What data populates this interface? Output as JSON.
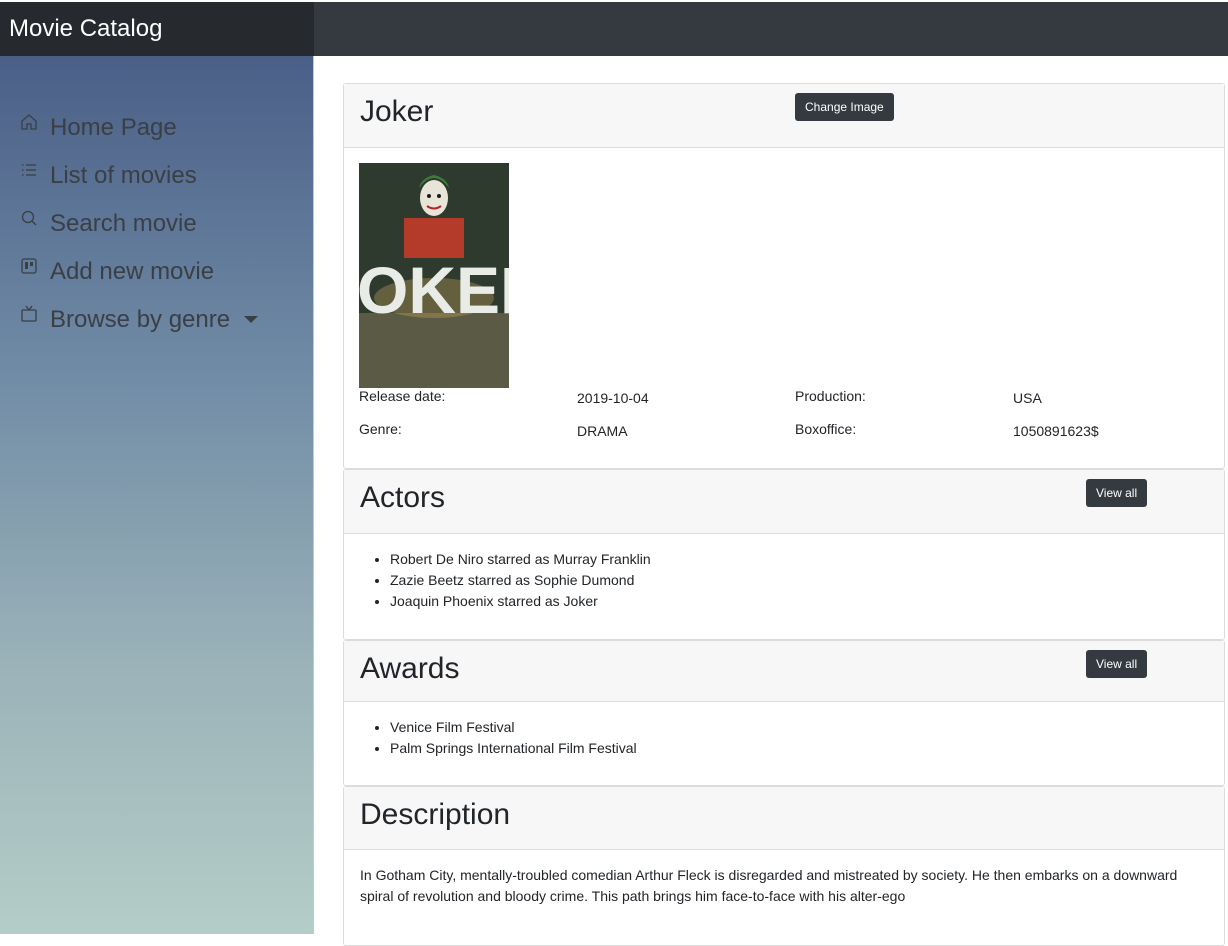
{
  "app": {
    "title": "Movie Catalog"
  },
  "sidebar": {
    "items": [
      {
        "label": "Home Page",
        "icon": "home-icon"
      },
      {
        "label": "List of movies",
        "icon": "list-icon"
      },
      {
        "label": "Search movie",
        "icon": "search-icon"
      },
      {
        "label": "Add new movie",
        "icon": "board-icon"
      },
      {
        "label": "Browse by genre",
        "icon": "tv-icon"
      }
    ]
  },
  "movie": {
    "title": "Joker",
    "change_image_label": "Change Image",
    "poster_text": "JOKER",
    "release_date_label": "Release date:",
    "release_date": "2019-10-04",
    "production_label": "Production:",
    "production": "USA",
    "genre_label": "Genre:",
    "genre": "DRAMA",
    "boxoffice_label": "Boxoffice:",
    "boxoffice": "1050891623$"
  },
  "actors": {
    "title": "Actors",
    "view_all_label": "View all",
    "items": [
      "Robert De Niro starred as Murray Franklin",
      "Zazie Beetz starred as Sophie Dumond",
      "Joaquin Phoenix starred as Joker"
    ]
  },
  "awards": {
    "title": "Awards",
    "view_all_label": "View all",
    "items": [
      "Venice Film Festival",
      "Palm Springs International Film Festival"
    ]
  },
  "description": {
    "title": "Description",
    "text": "In Gotham City, mentally-troubled comedian Arthur Fleck is disregarded and mistreated by society. He then embarks on a downward spiral of revolution and bloody crime. This path brings him face-to-face with his alter-ego"
  }
}
